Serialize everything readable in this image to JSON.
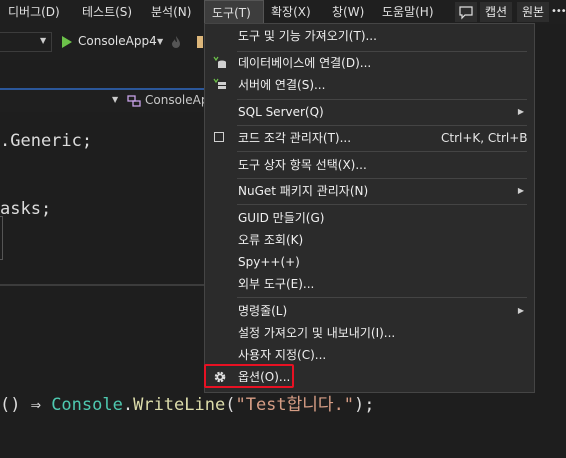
{
  "menubar": {
    "items": [
      "디버그(D)",
      "테스트(S)",
      "분석(N)",
      "도구(T)",
      "확장(X)",
      "창(W)",
      "도움말(H)"
    ],
    "caption_label": "캡션",
    "source_label": "원본",
    "more_label": "•••"
  },
  "toolbar": {
    "project_label": "ConsoleApp4",
    "run_icon": "play-icon"
  },
  "tab": {
    "scope_label": "ConsoleAp"
  },
  "editor": {
    "line1": ".Generic;",
    "line2": "asks;",
    "line3_prefix": "() ⇒ ",
    "line3_class": "Console",
    "line3_dot": ".",
    "line3_method": "WriteLine",
    "line3_open": "(",
    "line3_string": "\"Test합니다.\"",
    "line3_close": ");"
  },
  "tools_menu": {
    "get_tools": "도구 및 기능 가져오기(T)...",
    "connect_db": "데이터베이스에 연결(D)...",
    "connect_server": "서버에 연결(S)...",
    "sql_server": "SQL Server(Q)",
    "code_snippets": "코드 조각 관리자(T)...",
    "code_snippets_shortcut": "Ctrl+K, Ctrl+B",
    "toolbox_items": "도구 상자 항목 선택(X)...",
    "nuget": "NuGet 패키지 관리자(N)",
    "create_guid": "GUID 만들기(G)",
    "error_lookup": "오류 조회(K)",
    "spy": "Spy++(+)",
    "external_tools": "외부 도구(E)...",
    "command_line": "명령줄(L)",
    "import_export": "설정 가져오기 및 내보내기(I)...",
    "customize": "사용자 지정(C)...",
    "options": "옵션(O)..."
  },
  "colors": {
    "accent": "#2b579a",
    "highlight_border": "#e81123",
    "code_class": "#4ec9b0",
    "code_method": "#dcdcaa",
    "code_string": "#d69d85"
  }
}
